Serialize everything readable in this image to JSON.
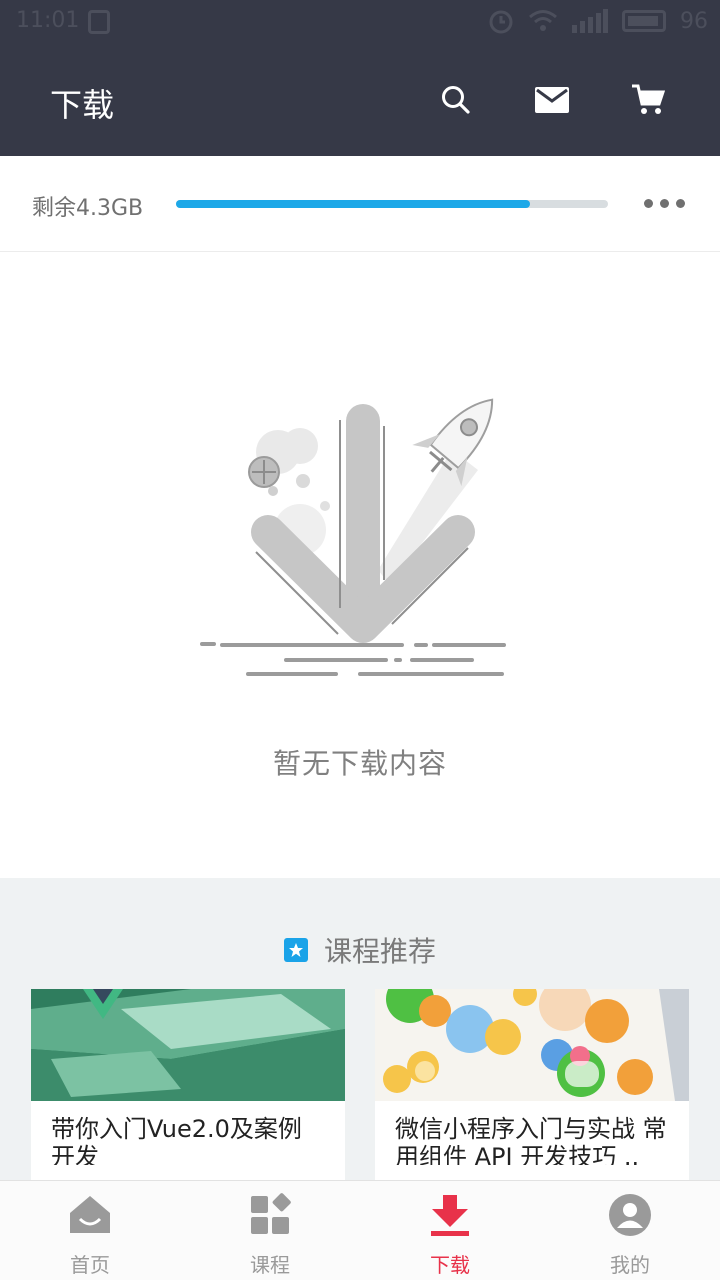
{
  "status_bar": {
    "time": "11:01",
    "battery": "96"
  },
  "header": {
    "title": "下载"
  },
  "storage": {
    "label": "剩余4.3GB",
    "used_fraction": 0.82
  },
  "empty_state": {
    "message": "暂无下载内容"
  },
  "recommend": {
    "title": "课程推荐",
    "cards": [
      {
        "title": "带你入门Vue2.0及案例开发"
      },
      {
        "title": "微信小程序入门与实战 常用组件 API 开发技巧 .."
      }
    ]
  },
  "tabbar": {
    "items": [
      {
        "label": "首页",
        "icon": "home-icon"
      },
      {
        "label": "课程",
        "icon": "courses-icon"
      },
      {
        "label": "下载",
        "icon": "download-icon",
        "active": true
      },
      {
        "label": "我的",
        "icon": "profile-icon"
      }
    ]
  },
  "colors": {
    "header_bg": "#363947",
    "accent_blue": "#1da8e8",
    "accent_red": "#e8324a",
    "section_bg": "#eff2f3"
  }
}
